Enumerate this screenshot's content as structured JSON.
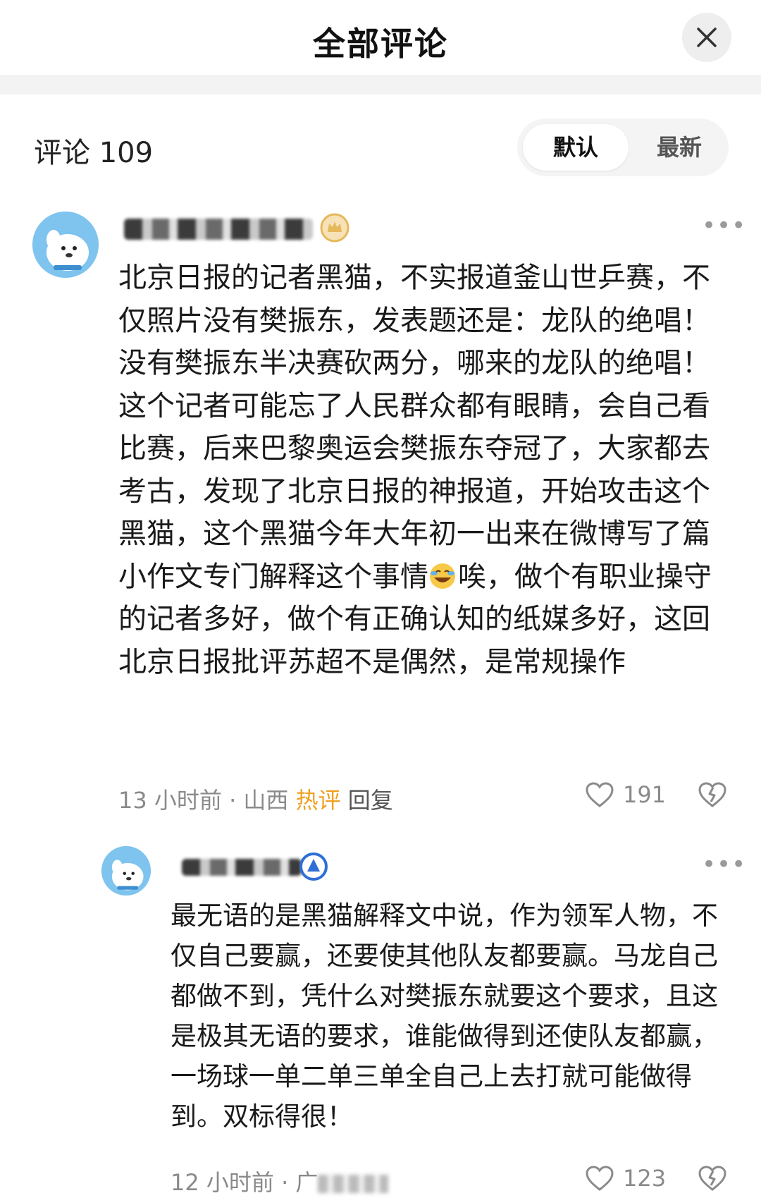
{
  "header": {
    "title": "全部评论"
  },
  "comments_count_label": "评论 109",
  "sort": {
    "default_label": "默认",
    "latest_label": "最新"
  },
  "comment": {
    "text_before_emoji": "北京日报的记者黑猫，不实报道釜山世乒赛，不仅照片没有樊振东，发表题还是：龙队的绝唱！没有樊振东半决赛砍两分，哪来的龙队的绝唱！这个记者可能忘了人民群众都有眼睛，会自己看比赛，后来巴黎奥运会樊振东夺冠了，大家都去考古，发现了北京日报的神报道，开始攻击这个黑猫，这个黑猫今年大年初一出来在微博写了篇小作文专门解释这个事情",
    "text_after_emoji": "唉，做个有职业操守的记者多好，做个有正确认知的纸媒多好，这回北京日报批评苏超不是偶然，是常规操作",
    "time": "13 小时前",
    "separator": "·",
    "location": "山西",
    "hot_tag": "热评",
    "reply_label": "回复",
    "likes": "191"
  },
  "reply": {
    "text": "最无语的是黑猫解释文中说，作为领军人物，不仅自己要赢，还要使其他队友都要赢。马龙自己都做不到，凭什么对樊振东就要这个要求，且这是极其无语的要求，谁能做得到还使队友都赢，一场球一单二单三单全自己上去打就可能做得到。双标得很！",
    "time": "12 小时前",
    "separator": "·",
    "location_partial": "广",
    "likes": "123"
  },
  "colors": {
    "hot": "#f0a020",
    "muted": "#8a8a8a",
    "avatar": "#7ec4ee",
    "badge_gold": "#e6b85c",
    "badge_blue": "#2f6fd6"
  },
  "icons": [
    "close-icon",
    "more-icon",
    "heart-icon",
    "dislike-heart-icon",
    "level-badge-icon",
    "emoji-laugh-cry-icon"
  ]
}
